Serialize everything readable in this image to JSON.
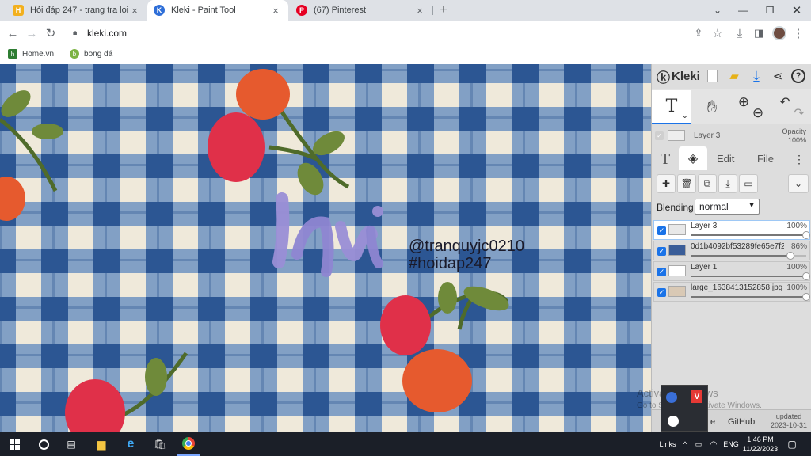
{
  "browser": {
    "tabs": [
      {
        "title": "Hỏi đáp 247 - trang tra loi",
        "favicon": "hoidap-favicon",
        "favicon_color": "#f2b01e",
        "favicon_glyph": "H"
      },
      {
        "title": "Kleki - Paint Tool",
        "favicon": "kleki-favicon",
        "favicon_color": "#2f6fd8",
        "favicon_glyph": "K"
      },
      {
        "title": "(67) Pinterest",
        "favicon": "pinterest-favicon",
        "favicon_color": "#e60023",
        "favicon_glyph": "P"
      }
    ],
    "new_tab_glyph": "+",
    "close_glyph": "×",
    "url": "kleki.com",
    "bookmarks": [
      {
        "label": "Home.vn",
        "icon_color": "#2e7d32",
        "glyph": "h"
      },
      {
        "label": "bong đá",
        "icon_color": "#7cb342",
        "glyph": "b"
      }
    ]
  },
  "canvas": {
    "watermark_line1": "@tranquyjc0210",
    "watermark_line2": "#hoidap247",
    "palette": {
      "fabric": "#efe9da",
      "check_light": "#6f93c2",
      "check_dark": "#2c5693",
      "cherry_red": "#e03049",
      "cherry_orange": "#e65a2e",
      "leaf": "#6f8a3a",
      "stem": "#4f6b2a",
      "lettering": "#9a8fd6"
    }
  },
  "kleki": {
    "logo": "Kleki",
    "current_layer_name": "Layer 3",
    "opacity_label": "Opacity",
    "opacity_value": "100%",
    "tabs": {
      "edit": "Edit",
      "file": "File"
    },
    "blending_label": "Blending",
    "blending_value": "normal",
    "layers": [
      {
        "name": "Layer 3",
        "opacity": "100%",
        "opacity_value": 1.0,
        "selected": true,
        "thumb": "#e8e8e8"
      },
      {
        "name": "0d1b4092bf53289fe65e7f2e8",
        "opacity": "86%",
        "opacity_value": 0.86,
        "selected": false,
        "thumb": "#3a5d98"
      },
      {
        "name": "Layer 1",
        "opacity": "100%",
        "opacity_value": 1.0,
        "selected": false,
        "thumb": "#ffffff"
      },
      {
        "name": "large_1638413152858.jpg",
        "opacity": "100%",
        "opacity_value": 1.0,
        "selected": false,
        "thumb": "#d9c9b5"
      }
    ],
    "footer": {
      "partial_link": "e",
      "github": "GitHub",
      "updated_label": "updated",
      "updated_date": "2023-10-31"
    }
  },
  "overlay": {
    "activate_line1": "Activate Windows",
    "activate_line2": "Go to Settings to activate Windows."
  },
  "taskbar": {
    "links_label": "Links",
    "language": "ENG",
    "time": "1:46 PM",
    "date": "11/22/2023"
  }
}
